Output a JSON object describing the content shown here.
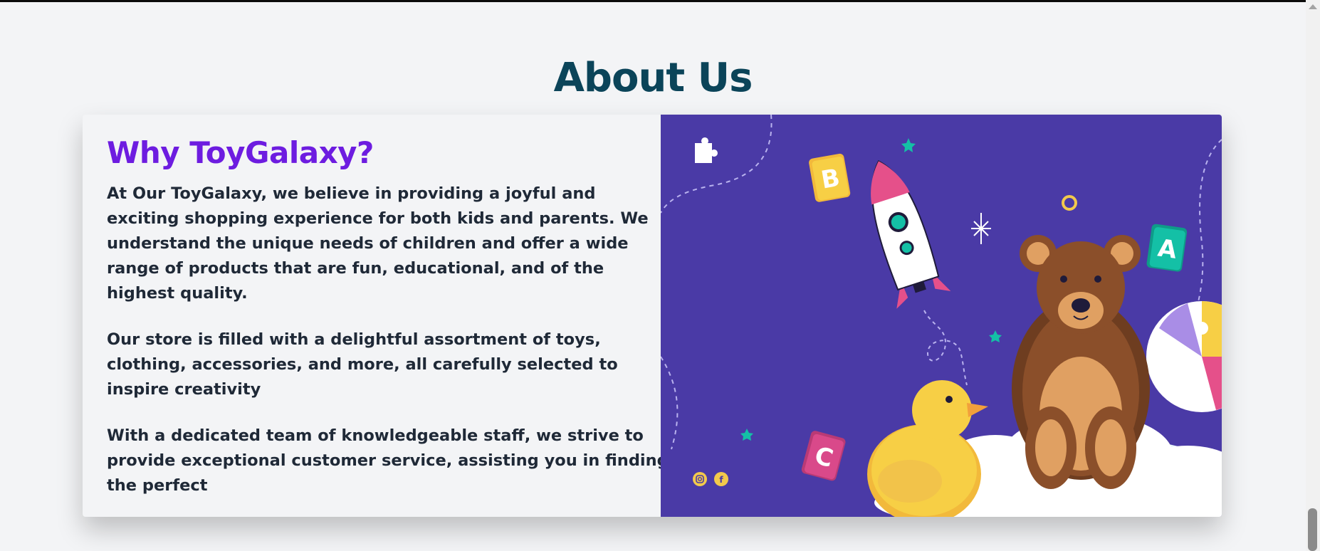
{
  "section": {
    "title": "About Us"
  },
  "about": {
    "heading": "Why ToyGalaxy?",
    "paragraphs": [
      "At Our ToyGalaxy, we believe in providing a joyful and exciting shopping experience for both kids and parents. We understand the unique needs of children and offer a wide range of products that are fun, educational, and of the highest quality.",
      "Our store is filled with a delightful assortment of toys, clothing, accessories, and more, all carefully selected to inspire creativity",
      "With a dedicated team of knowledgeable staff, we strive to provide exceptional customer service, assisting you in finding the perfect"
    ]
  },
  "illustration": {
    "block_letters": [
      "B",
      "A",
      "C"
    ],
    "social_icons": [
      "instagram-icon",
      "facebook-icon"
    ],
    "colors": {
      "background": "#4a3aa6",
      "bear": "#8b4f2a",
      "duck": "#f7cf45",
      "accent_pink": "#e5508a",
      "accent_teal": "#14c0a6"
    }
  },
  "theme": {
    "title_color": "#0b4459",
    "heading_color": "#6d1ce0",
    "text_color": "#1f2937"
  }
}
